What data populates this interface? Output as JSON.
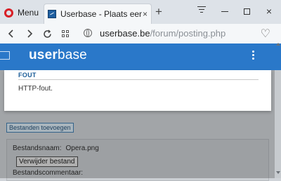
{
  "browser": {
    "menu_label": "Menu",
    "tab_title": "Userbase - Plaats een nieu",
    "url_domain": "userbase.be",
    "url_path": "/forum/posting.php",
    "close_glyph": "×",
    "newtab_glyph": "+"
  },
  "site": {
    "logo_user": "user",
    "logo_base": "base"
  },
  "dialog": {
    "title": "FOUT",
    "message": "HTTP-fout."
  },
  "attachments": {
    "upload_button": "Bestanden toevoegen",
    "filename_label": "Bestandsnaam:",
    "filename_value": "Opera.png",
    "delete_button": "Verwijder bestand",
    "comment_label": "Bestandscommentaar:"
  },
  "colors": {
    "header_blue": "#2a78c9",
    "dialog_title": "#1c5d98",
    "opera_red": "#d81f26"
  }
}
